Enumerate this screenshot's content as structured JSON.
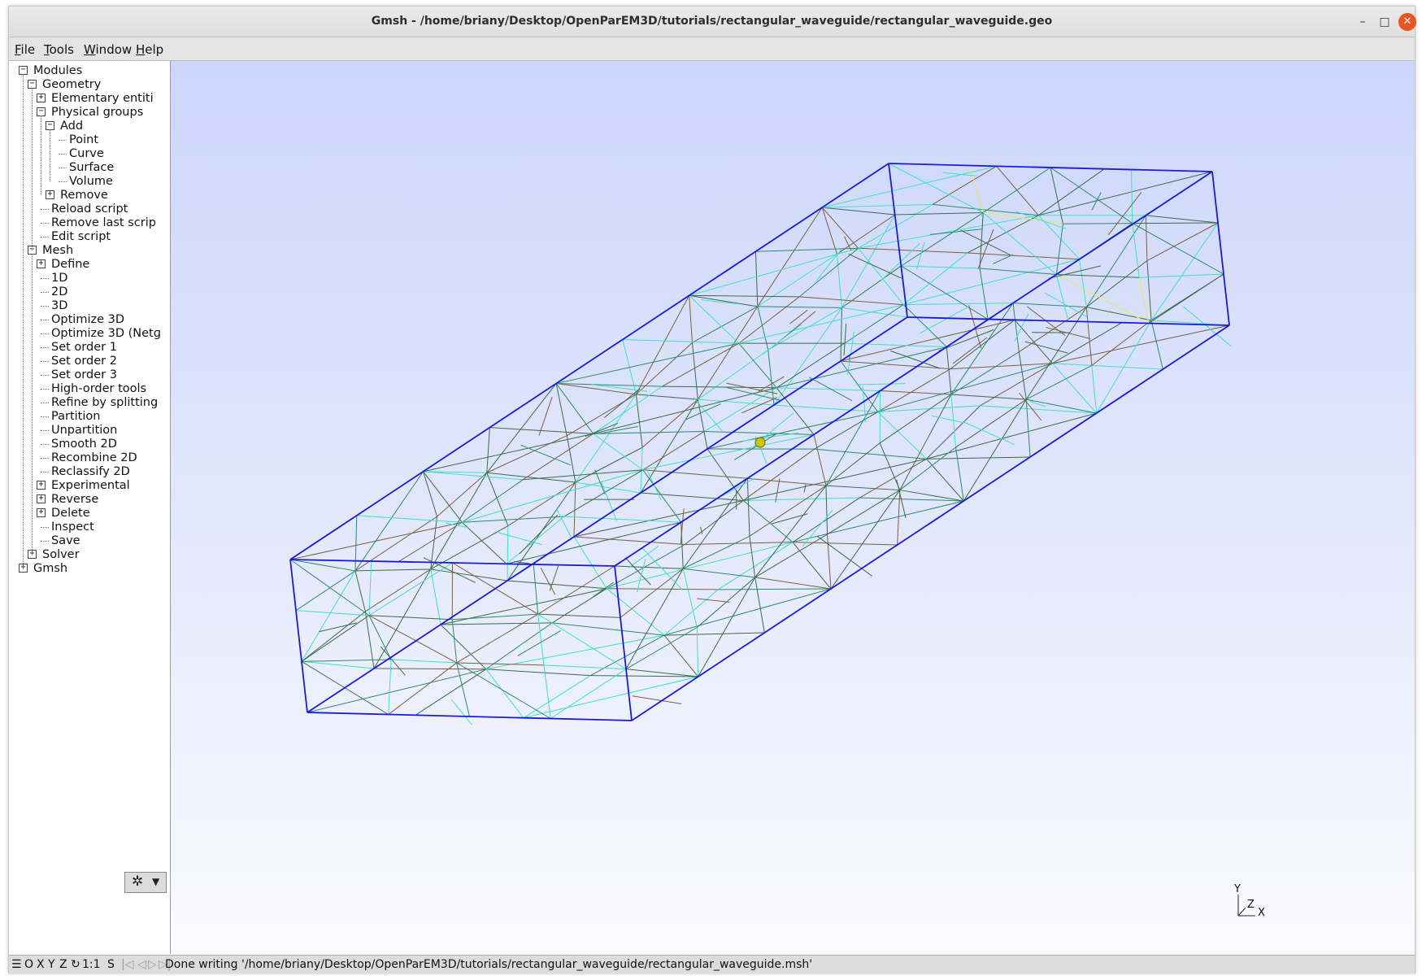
{
  "window": {
    "title": "Gmsh - /home/briany/Desktop/OpenParEM3D/tutorials/rectangular_waveguide/rectangular_waveguide.geo"
  },
  "menu": [
    {
      "underline": "F",
      "rest": "ile"
    },
    {
      "underline": "T",
      "rest": "ools"
    },
    {
      "underline": "W",
      "rest": "indow"
    },
    {
      "underline": "H",
      "rest": "elp"
    }
  ],
  "tree": [
    {
      "label": "Modules",
      "level": 0,
      "box": "-"
    },
    {
      "label": "Geometry",
      "level": 1,
      "box": "-"
    },
    {
      "label": "Elementary entiti",
      "level": 2,
      "box": "+"
    },
    {
      "label": "Physical groups",
      "level": 2,
      "box": "-"
    },
    {
      "label": "Add",
      "level": 3,
      "box": "-"
    },
    {
      "label": "Point",
      "level": 4,
      "box": ""
    },
    {
      "label": "Curve",
      "level": 4,
      "box": ""
    },
    {
      "label": "Surface",
      "level": 4,
      "box": ""
    },
    {
      "label": "Volume",
      "level": 4,
      "box": ""
    },
    {
      "label": "Remove",
      "level": 3,
      "box": "+"
    },
    {
      "label": "Reload script",
      "level": 2,
      "box": ""
    },
    {
      "label": "Remove last scrip",
      "level": 2,
      "box": ""
    },
    {
      "label": "Edit script",
      "level": 2,
      "box": ""
    },
    {
      "label": "Mesh",
      "level": 1,
      "box": "-"
    },
    {
      "label": "Define",
      "level": 2,
      "box": "+"
    },
    {
      "label": "1D",
      "level": 2,
      "box": ""
    },
    {
      "label": "2D",
      "level": 2,
      "box": ""
    },
    {
      "label": "3D",
      "level": 2,
      "box": ""
    },
    {
      "label": "Optimize 3D",
      "level": 2,
      "box": ""
    },
    {
      "label": "Optimize 3D (Netɡ",
      "level": 2,
      "box": ""
    },
    {
      "label": "Set order 1",
      "level": 2,
      "box": ""
    },
    {
      "label": "Set order 2",
      "level": 2,
      "box": ""
    },
    {
      "label": "Set order 3",
      "level": 2,
      "box": ""
    },
    {
      "label": "High-order tools",
      "level": 2,
      "box": ""
    },
    {
      "label": "Refine by splitting",
      "level": 2,
      "box": ""
    },
    {
      "label": "Partition",
      "level": 2,
      "box": ""
    },
    {
      "label": "Unpartition",
      "level": 2,
      "box": ""
    },
    {
      "label": "Smooth 2D",
      "level": 2,
      "box": ""
    },
    {
      "label": "Recombine 2D",
      "level": 2,
      "box": ""
    },
    {
      "label": "Reclassify 2D",
      "level": 2,
      "box": ""
    },
    {
      "label": "Experimental",
      "level": 2,
      "box": "+"
    },
    {
      "label": "Reverse",
      "level": 2,
      "box": "+"
    },
    {
      "label": "Delete",
      "level": 2,
      "box": "+"
    },
    {
      "label": "Inspect",
      "level": 2,
      "box": ""
    },
    {
      "label": "Save",
      "level": 2,
      "box": ""
    },
    {
      "label": "Solver",
      "level": 1,
      "box": "+"
    },
    {
      "label": "Gmsh",
      "level": 0,
      "box": "+"
    }
  ],
  "axes": {
    "x": "X",
    "y": "Y",
    "z": "Z"
  },
  "status": {
    "buttons": [
      "☰",
      "O",
      "X",
      "Y",
      "Z",
      "↻",
      "1:1",
      "S"
    ],
    "message": "Done writing '/home/briany/Desktop/OpenParEM3D/tutorials/rectangular_waveguide/rectangular_waveguide.msh'"
  },
  "colors": {
    "boundary": "#1b1bd6",
    "mesh_dark": "#3c6a4a",
    "mesh_cyan": "#40e0c8",
    "mesh_yellow": "#e8e860",
    "mesh_brown": "#7a6040"
  }
}
